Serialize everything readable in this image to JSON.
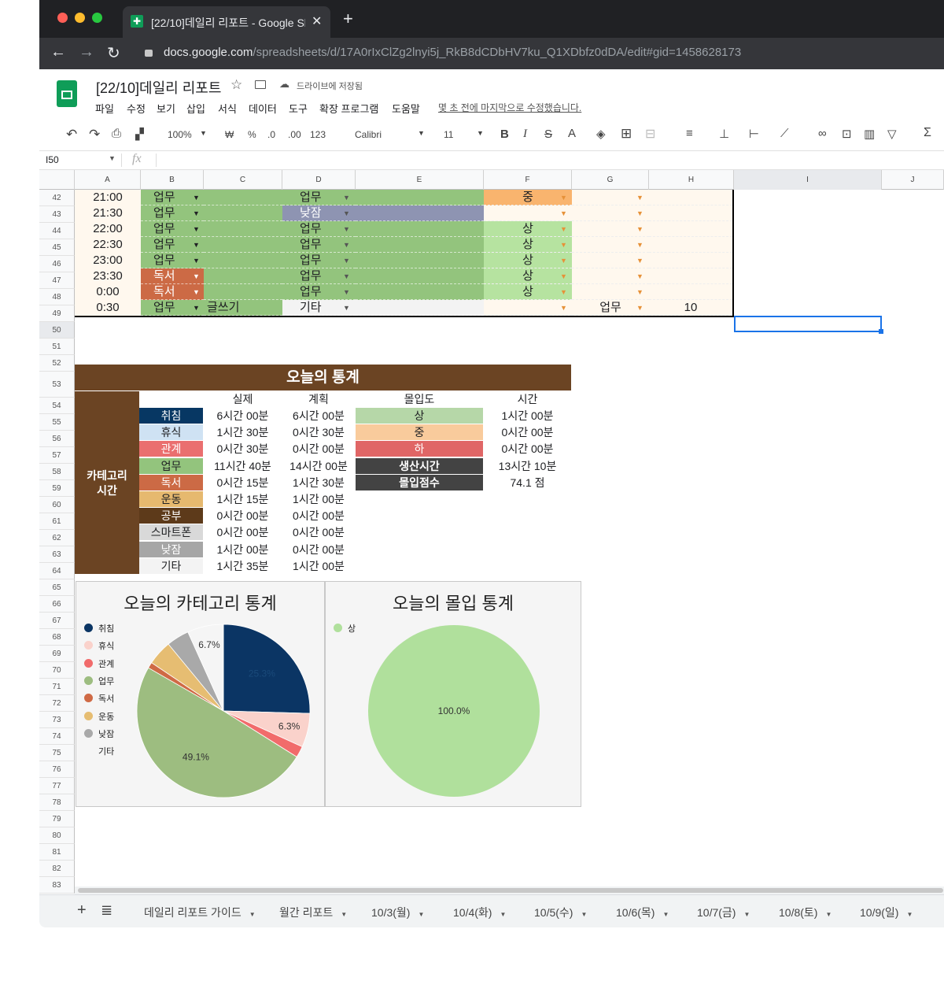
{
  "browser": {
    "tab_title": "[22/10]데일리 리포트 - Google Sh",
    "url_domain": "docs.google.com",
    "url_path": "/spreadsheets/d/17A0rIxClZg2lnyi5j_RkB8dCDbHV7ku_Q1XDbfz0dDA/edit#gid=1458628173"
  },
  "doc": {
    "title": "[22/10]데일리 리포트",
    "save_status": "드라이브에 저장됨",
    "last_edit": "몇 초 전에 마지막으로 수정했습니다.",
    "menus": [
      "파일",
      "수정",
      "보기",
      "삽입",
      "서식",
      "데이터",
      "도구",
      "확장 프로그램",
      "도움말"
    ]
  },
  "toolbar": {
    "zoom": "100%",
    "currency": "₩",
    "percent": "%",
    "dec_minus": ".0",
    "dec_plus": ".00",
    "format": "123",
    "font": "Calibri",
    "size": "11"
  },
  "formula_bar": {
    "cell_ref": "I50",
    "fx": "fx"
  },
  "columns": [
    "A",
    "B",
    "C",
    "D",
    "E",
    "F",
    "G",
    "H",
    "I",
    "J"
  ],
  "row_numbers": [
    "42",
    "43",
    "44",
    "45",
    "46",
    "47",
    "48",
    "49",
    "50",
    "51",
    "52",
    "53",
    "54",
    "55",
    "56",
    "57",
    "58",
    "59",
    "60",
    "61",
    "62",
    "63",
    "64",
    "65",
    "66",
    "67",
    "68",
    "69",
    "70",
    "71",
    "72",
    "73",
    "74",
    "75",
    "76",
    "77",
    "78",
    "79",
    "80",
    "81",
    "82",
    "83"
  ],
  "schedule": [
    {
      "time": "21:00",
      "b": "업무",
      "c": "",
      "d": "업무",
      "f": "중",
      "g": "",
      "h": ""
    },
    {
      "time": "21:30",
      "b": "업무",
      "c": "",
      "d": "낮잠",
      "f": "",
      "g": "",
      "h": ""
    },
    {
      "time": "22:00",
      "b": "업무",
      "c": "",
      "d": "업무",
      "f": "상",
      "g": "",
      "h": ""
    },
    {
      "time": "22:30",
      "b": "업무",
      "c": "",
      "d": "업무",
      "f": "상",
      "g": "",
      "h": ""
    },
    {
      "time": "23:00",
      "b": "업무",
      "c": "",
      "d": "업무",
      "f": "상",
      "g": "",
      "h": ""
    },
    {
      "time": "23:30",
      "b": "독서",
      "c": "",
      "d": "업무",
      "f": "상",
      "g": "",
      "h": ""
    },
    {
      "time": "0:00",
      "b": "독서",
      "c": "",
      "d": "업무",
      "f": "상",
      "g": "",
      "h": ""
    },
    {
      "time": "0:30",
      "b": "업무",
      "c": "글쓰기",
      "d": "기타",
      "f": "",
      "g": "업무",
      "h": "10"
    }
  ],
  "stats": {
    "title": "오늘의 통계",
    "side_label_1": "카테고리",
    "side_label_2": "시간",
    "headers": {
      "actual": "실제",
      "plan": "계획",
      "focus": "몰입도",
      "time": "시간"
    },
    "categories": [
      {
        "name": "취침",
        "actual": "6시간 00분",
        "plan": "6시간 00분",
        "color": "#073763",
        "text": "#ffffff"
      },
      {
        "name": "휴식",
        "actual": "1시간 30분",
        "plan": "0시간 30분",
        "color": "#cfe2f3",
        "text": "#202124"
      },
      {
        "name": "관계",
        "actual": "0시간 30분",
        "plan": "0시간 00분",
        "color": "#ea6f6f",
        "text": "#ffffff"
      },
      {
        "name": "업무",
        "actual": "11시간 40분",
        "plan": "14시간 00분",
        "color": "#93c47d",
        "text": "#202124"
      },
      {
        "name": "독서",
        "actual": "0시간 15분",
        "plan": "1시간 30분",
        "color": "#cc6a45",
        "text": "#ffffff"
      },
      {
        "name": "운동",
        "actual": "1시간 15분",
        "plan": "1시간 00분",
        "color": "#e6b96f",
        "text": "#202124"
      },
      {
        "name": "공부",
        "actual": "0시간 00분",
        "plan": "0시간 00분",
        "color": "#5d3a1a",
        "text": "#ffffff"
      },
      {
        "name": "스마트폰",
        "actual": "0시간 00분",
        "plan": "0시간 00분",
        "color": "#d9d9d9",
        "text": "#202124"
      },
      {
        "name": "낮잠",
        "actual": "1시간 00분",
        "plan": "0시간 00분",
        "color": "#a6a6a6",
        "text": "#ffffff"
      },
      {
        "name": "기타",
        "actual": "1시간 35분",
        "plan": "1시간 00분",
        "color": "#f3f3f3",
        "text": "#202124"
      }
    ],
    "focus": [
      {
        "name": "상",
        "time": "1시간 00분",
        "color": "#b6d7a8",
        "text": "#202124"
      },
      {
        "name": "중",
        "time": "0시간 00분",
        "color": "#f9cb9c",
        "text": "#202124"
      },
      {
        "name": "하",
        "time": "0시간 00분",
        "color": "#e06666",
        "text": "#ffffff"
      },
      {
        "name": "생산시간",
        "time": "13시간 10분",
        "color": "#434343",
        "text": "#ffffff"
      },
      {
        "name": "몰입점수",
        "time": "74.1 점",
        "color": "#434343",
        "text": "#ffffff"
      }
    ]
  },
  "chart_data": [
    {
      "type": "pie",
      "title": "오늘의 카테고리 통계",
      "legend": [
        "취침",
        "휴식",
        "관계",
        "업무",
        "독서",
        "운동",
        "낮잠",
        "기타"
      ],
      "colors": [
        "#0b3564",
        "#fad2cb",
        "#f16b6b",
        "#9dbd80",
        "#cf6a45",
        "#e6bd72",
        "#a9a9a9",
        "#f5f5f5"
      ],
      "values": [
        25.3,
        6.3,
        2.1,
        49.1,
        1.1,
        4.6,
        4.2,
        6.7
      ],
      "labels": [
        "25.3%",
        "6.3%",
        "",
        "49.1%",
        "",
        "",
        "",
        "6.7%"
      ]
    },
    {
      "type": "pie",
      "title": "오늘의 몰입 통계",
      "legend": [
        "상"
      ],
      "colors": [
        "#b0e09c"
      ],
      "values": [
        100
      ],
      "labels": [
        "100.0%"
      ]
    }
  ],
  "sheet_tabs": [
    "데일리 리포트 가이드",
    "월간 리포트",
    "10/3(월)",
    "10/4(화)",
    "10/5(수)",
    "10/6(목)",
    "10/7(금)",
    "10/8(토)",
    "10/9(일)"
  ]
}
